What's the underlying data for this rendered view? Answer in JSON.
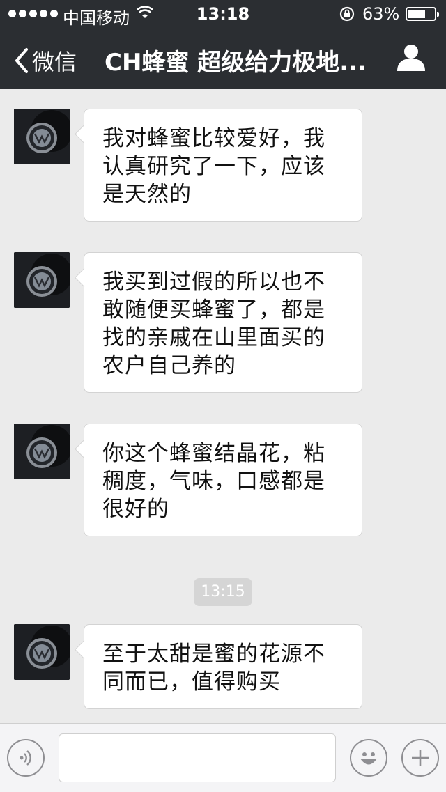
{
  "status_bar": {
    "carrier": "中国移动",
    "time": "13:18",
    "battery": "63%",
    "battery_level": 0.63
  },
  "nav": {
    "back_label": "微信",
    "title": "CH蜂蜜 超级给力极地..."
  },
  "messages": [
    {
      "text": "我对蜂蜜比较爱好，我认真研究了一下，应该是天然的"
    },
    {
      "text": "我买到过假的所以也不敢随便买蜂蜜了，都是找的亲戚在山里面买的农户自己养的"
    },
    {
      "text": "你这个蜂蜜结晶花，粘稠度，气味，口感都是很好的"
    },
    {
      "text": "至于太甜是蜜的花源不同而已，值得购买"
    }
  ],
  "timestamp": "13:15",
  "icons": {
    "back": "chevron-left-icon",
    "profile": "person-icon",
    "voice": "voice-icon",
    "emoji": "emoji-icon",
    "plus": "plus-icon"
  },
  "colors": {
    "nav_bg": "#2b2e32",
    "chat_bg": "#ebebeb",
    "bubble_bg": "#ffffff"
  }
}
